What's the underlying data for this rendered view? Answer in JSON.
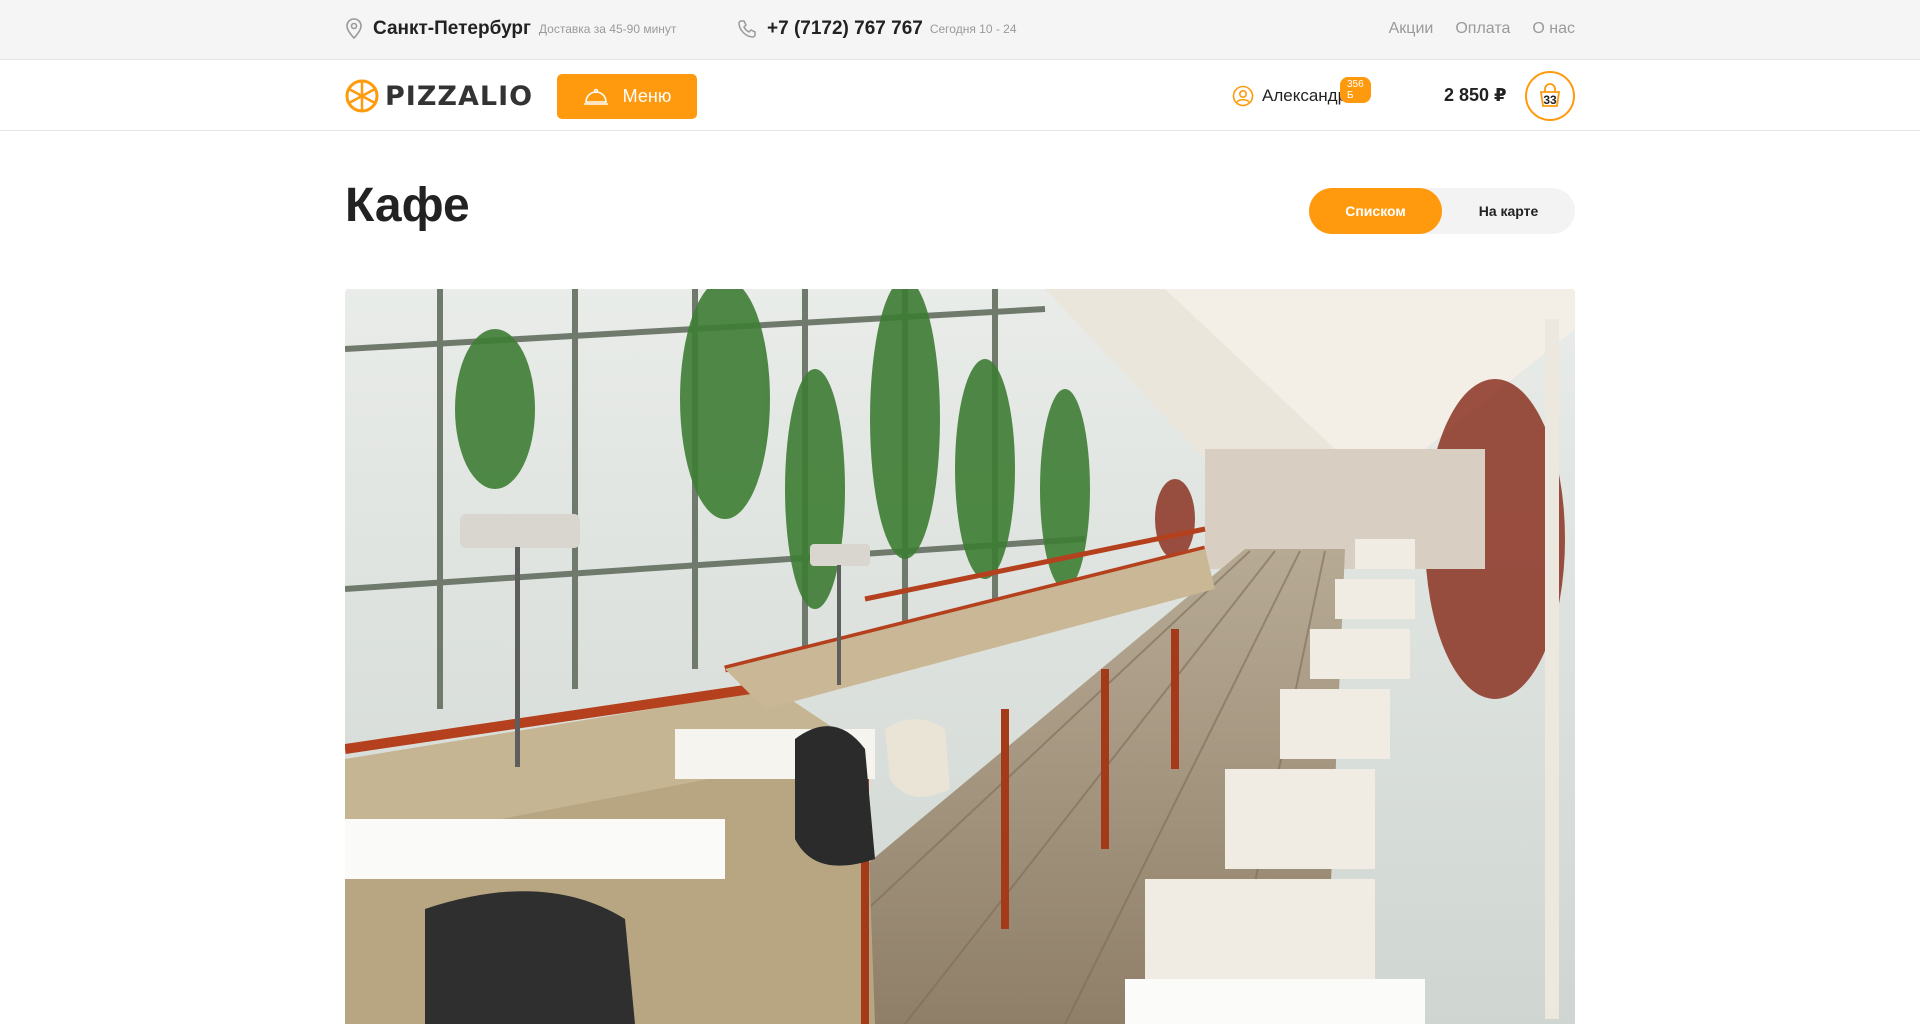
{
  "topbar": {
    "city": "Санкт-Петербург",
    "delivery": "Доставка за 45-90 минут",
    "phone": "+7 (7172) 767 767",
    "hours": "Сегодня 10 - 24",
    "links": [
      "Акции",
      "Оплата",
      "О нас"
    ]
  },
  "header": {
    "logo_text": "PIZZALIO",
    "menu_label": "Меню",
    "user_name": "Александр",
    "bonus": "356 Б",
    "cart_total": "2 850 ₽",
    "cart_count": "33"
  },
  "main": {
    "title": "Кафе",
    "view_options": [
      "Списком",
      "На карте"
    ],
    "active_view": "Списком"
  },
  "colors": {
    "accent": "#ff9a0e",
    "text": "#222222",
    "muted": "#9a9a9a",
    "topbar_bg": "#f5f5f5"
  },
  "icons": [
    "location-pin-icon",
    "phone-icon",
    "cloche-icon",
    "user-icon",
    "basket-icon",
    "logo-pizza-icon"
  ]
}
